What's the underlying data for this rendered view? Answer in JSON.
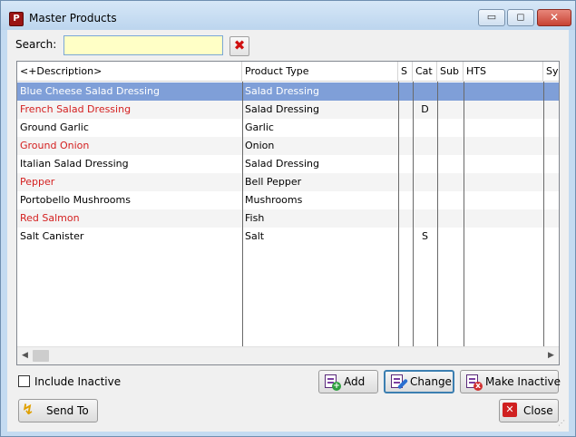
{
  "window": {
    "title": "Master Products",
    "min_glyph": "▭",
    "max_glyph": "◻",
    "close_glyph": "✕",
    "app_icon_glyph": "P"
  },
  "search": {
    "label": "Search:",
    "value": ""
  },
  "clear_glyph": "✖",
  "table": {
    "columns": [
      "<+Description>",
      "Product Type",
      "S",
      "Cat",
      "Sub",
      "HTS",
      "Sys"
    ],
    "rows": [
      {
        "description": "Blue Cheese Salad Dressing",
        "type": "Salad Dressing",
        "s": "",
        "cat": "",
        "sub": "",
        "hts": "",
        "sys": "",
        "red": false,
        "selected": true
      },
      {
        "description": "French Salad Dressing",
        "type": "Salad Dressing",
        "s": "",
        "cat": "D",
        "sub": "",
        "hts": "",
        "sys": "",
        "red": true,
        "selected": false
      },
      {
        "description": "Ground Garlic",
        "type": "Garlic",
        "s": "",
        "cat": "",
        "sub": "",
        "hts": "",
        "sys": "",
        "red": false,
        "selected": false
      },
      {
        "description": "Ground Onion",
        "type": "Onion",
        "s": "",
        "cat": "",
        "sub": "",
        "hts": "",
        "sys": "",
        "red": true,
        "selected": false
      },
      {
        "description": "Italian Salad Dressing",
        "type": "Salad Dressing",
        "s": "",
        "cat": "",
        "sub": "",
        "hts": "",
        "sys": "",
        "red": false,
        "selected": false
      },
      {
        "description": "Pepper",
        "type": "Bell Pepper",
        "s": "",
        "cat": "",
        "sub": "",
        "hts": "",
        "sys": "",
        "red": true,
        "selected": false
      },
      {
        "description": "Portobello Mushrooms",
        "type": "Mushrooms",
        "s": "",
        "cat": "",
        "sub": "",
        "hts": "",
        "sys": "",
        "red": false,
        "selected": false
      },
      {
        "description": "Red Salmon",
        "type": "Fish",
        "s": "",
        "cat": "",
        "sub": "",
        "hts": "",
        "sys": "",
        "red": true,
        "selected": false
      },
      {
        "description": "Salt Canister",
        "type": "Salt",
        "s": "",
        "cat": "S",
        "sub": "",
        "hts": "",
        "sys": "",
        "red": false,
        "selected": false
      }
    ]
  },
  "scroll": {
    "left_glyph": "◀",
    "right_glyph": "▶"
  },
  "include_inactive": {
    "label": "Include Inactive",
    "checked": false
  },
  "buttons": {
    "add": "Add",
    "change": "Change",
    "make_inactive": "Make Inactive",
    "send_to": "Send To",
    "close": "Close",
    "add_badge": "+",
    "inactive_badge": "x",
    "send_glyph": "↯",
    "close_glyph": "✕"
  },
  "colors": {
    "selected_row": "#7f9fd8",
    "inactive_text": "#d42020",
    "search_bg": "#ffffc6"
  }
}
